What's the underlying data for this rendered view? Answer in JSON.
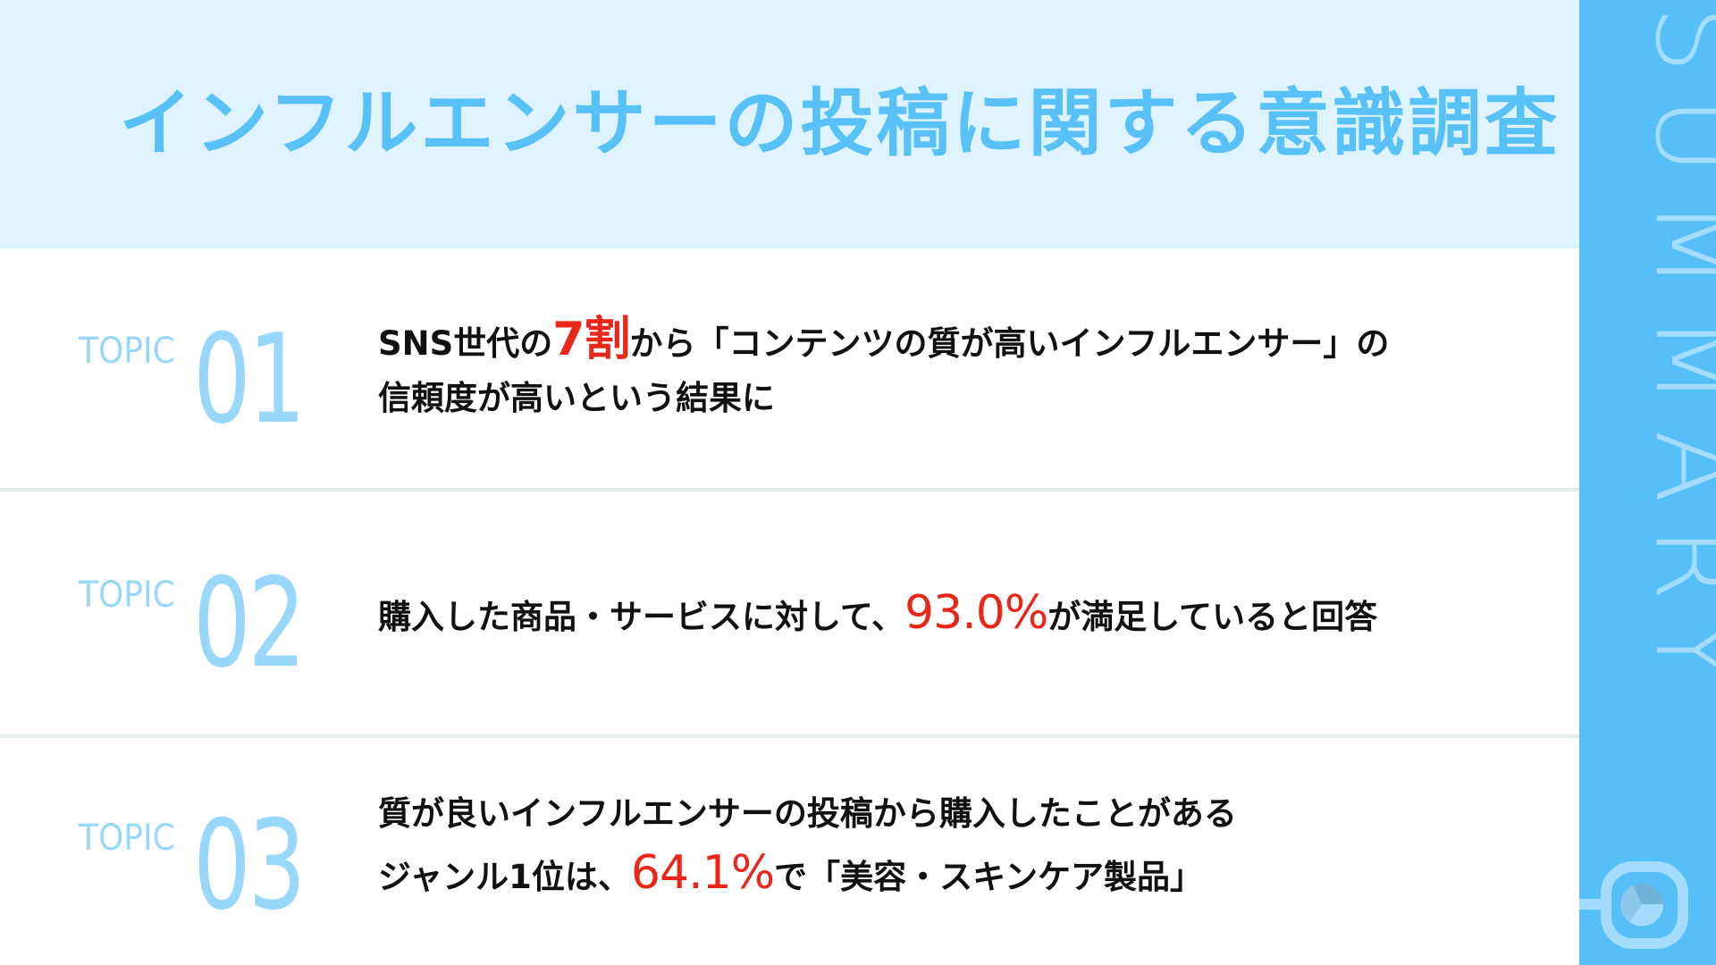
{
  "header": {
    "title": "インフルエンサーの投稿に関する意識調査"
  },
  "sidebar": {
    "label": "SUMMARY",
    "icon": "magnifier-pie-chart-icon"
  },
  "colors": {
    "accent_blue": "#57bff8",
    "header_bg": "#dff3ff",
    "title_blue": "#58c1f8",
    "topic_blue": "#9ad8fb",
    "highlight_red": "#e8261a",
    "text_dark": "#111111"
  },
  "topics": [
    {
      "label": "TOPIC",
      "number": "01",
      "lines": [
        {
          "before": "SNS世代の",
          "highlight": "7割",
          "after": "から「コンテンツの質が高いインフルエンサー」の"
        },
        {
          "before": "信頼度が高いという結果に",
          "highlight": "",
          "after": ""
        }
      ]
    },
    {
      "label": "TOPIC",
      "number": "02",
      "lines": [
        {
          "before": "購入した商品・サービスに対して、",
          "highlight": "93.0%",
          "after": "が満足していると回答"
        }
      ]
    },
    {
      "label": "TOPIC",
      "number": "03",
      "lines": [
        {
          "before": "質が良いインフルエンサーの投稿から購入したことがある",
          "highlight": "",
          "after": ""
        },
        {
          "before": "ジャンル1位は、",
          "highlight": "64.1%",
          "after": "で「美容・スキンケア製品」"
        }
      ]
    }
  ]
}
